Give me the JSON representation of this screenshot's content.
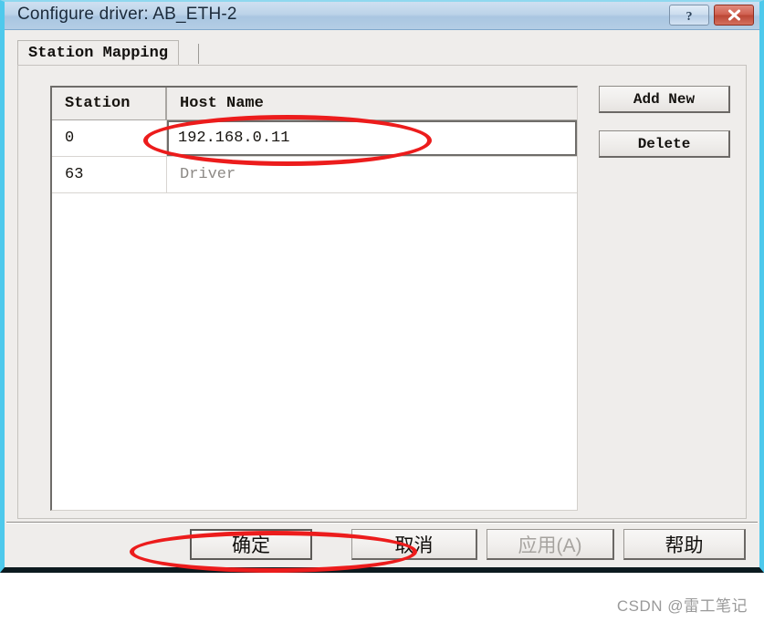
{
  "window": {
    "title": "Configure driver: AB_ETH-2",
    "help_button": "?",
    "close_button": "✕",
    "accent_border_color": "#4ec9ec",
    "titlebar_color": "#b4cde5"
  },
  "tabs": [
    {
      "label": "Station Mapping",
      "selected": true
    }
  ],
  "grid": {
    "columns": [
      "Station",
      "Host Name"
    ],
    "rows": [
      {
        "station": "0",
        "host": "192.168.0.11",
        "editing": true,
        "readonly": false
      },
      {
        "station": "63",
        "host": "Driver",
        "editing": false,
        "readonly": true
      }
    ]
  },
  "side_buttons": [
    {
      "label": "Add New",
      "enabled": true
    },
    {
      "label": "Delete",
      "enabled": true
    }
  ],
  "footer_buttons": [
    {
      "label": "确定",
      "enabled": true,
      "default": true
    },
    {
      "label": "取消",
      "enabled": true,
      "default": false
    },
    {
      "label": "应用(A)",
      "enabled": false,
      "default": false
    },
    {
      "label": "帮助",
      "enabled": true,
      "default": false
    }
  ],
  "annotations": {
    "color": "#ec1c1c",
    "shapes": [
      "ellipse-around-host-name-value",
      "ellipse-around-ok-button"
    ]
  },
  "watermark": {
    "text": "CSDN @雷工笔记"
  }
}
